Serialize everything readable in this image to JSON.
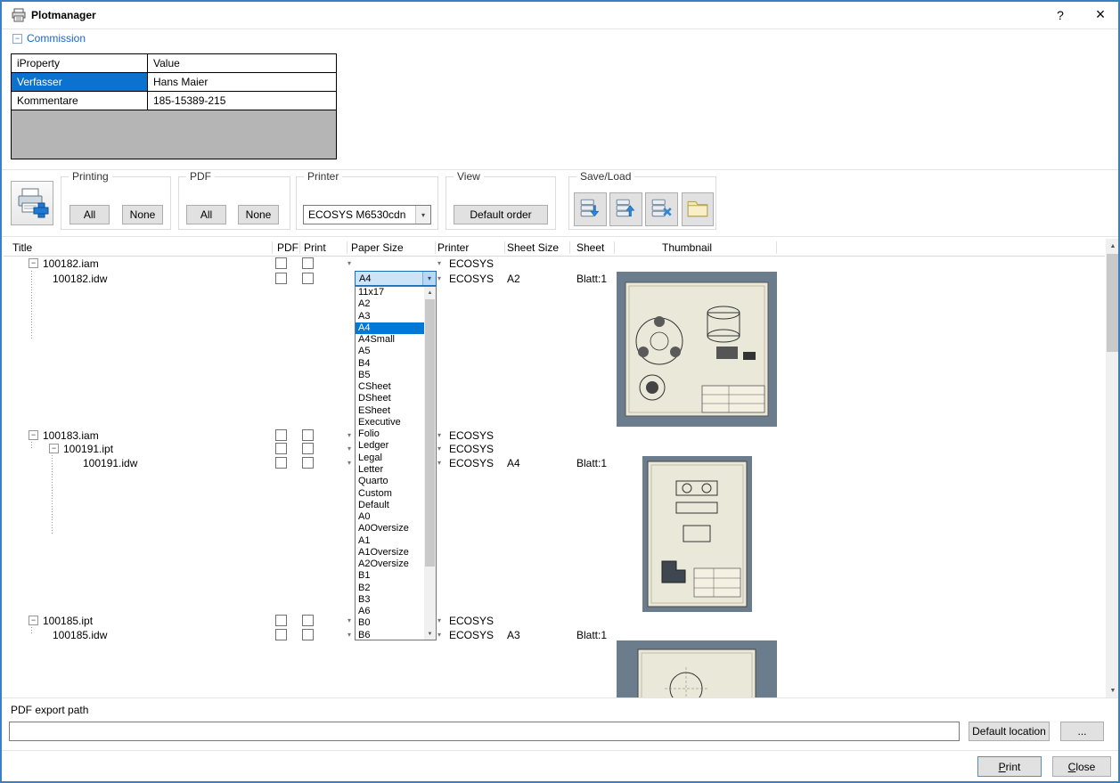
{
  "window": {
    "title": "Plotmanager"
  },
  "glyphs": {
    "help": "?",
    "close": "×",
    "collapse": "−",
    "chevron": "▾",
    "scroll_up": "▲",
    "scroll_down": "▼"
  },
  "colors": {
    "selection_blue": "#0b72cf",
    "dropdown_selection": "#0078d7",
    "window_border": "#3a80c4",
    "thumbnail_background": "#6b7d8c",
    "drawing_paper": "#eae8d8",
    "table_filler_gray": "#b5b5b5"
  },
  "commission": {
    "label": "Commission",
    "headers": {
      "property": "iProperty",
      "value": "Value"
    },
    "rows": [
      {
        "property": "Verfasser",
        "value": "Hans Maier"
      },
      {
        "property": "Kommentare",
        "value": "185-15389-215"
      }
    ]
  },
  "toolbar": {
    "printing_label": "Printing",
    "printing_all": "All",
    "printing_none": "None",
    "pdf_label": "PDF",
    "pdf_all": "All",
    "pdf_none": "None",
    "printer_label": "Printer",
    "printer_value": "ECOSYS M6530cdn",
    "view_label": "View",
    "default_order": "Default order",
    "saveload_label": "Save/Load"
  },
  "grid": {
    "columns": {
      "title": "Title",
      "pdf": "PDF",
      "print": "Print",
      "paper": "Paper Size",
      "printer": "Printer",
      "sheet_size": "Sheet Size",
      "sheet": "Sheet",
      "thumb": "Thumbnail"
    },
    "rows": [
      {
        "title": "100182.iam",
        "printer": "ECOSYS"
      },
      {
        "title": "100182.idw",
        "printer": "ECOSYS",
        "sheet_size": "A2",
        "sheet": "Blatt:1"
      },
      {
        "title": "100183.iam",
        "printer": "ECOSYS"
      },
      {
        "title": "100191.ipt",
        "printer": "ECOSYS"
      },
      {
        "title": "100191.idw",
        "printer": "ECOSYS",
        "sheet_size": "A4",
        "sheet": "Blatt:1"
      },
      {
        "title": "100185.ipt",
        "printer": "ECOSYS"
      },
      {
        "title": "100185.idw",
        "printer": "ECOSYS",
        "sheet_size": "A3",
        "sheet": "Blatt:1"
      }
    ]
  },
  "paper_dropdown": {
    "value": "A4",
    "selected": "A4",
    "options": [
      "11x17",
      "A2",
      "A3",
      "A4",
      "A4Small",
      "A5",
      "B4",
      "B5",
      "CSheet",
      "DSheet",
      "ESheet",
      "Executive",
      "Folio",
      "Ledger",
      "Legal",
      "Letter",
      "Quarto",
      "Custom",
      "Default",
      "A0",
      "A0Oversize",
      "A1",
      "A1Oversize",
      "A2Oversize",
      "B1",
      "B2",
      "B3",
      "A6",
      "B0",
      "B6"
    ]
  },
  "pdf_export": {
    "label": "PDF export path",
    "value": "",
    "default_location": "Default location",
    "browse": "..."
  },
  "footer": {
    "print": "Print",
    "close": "Close"
  }
}
